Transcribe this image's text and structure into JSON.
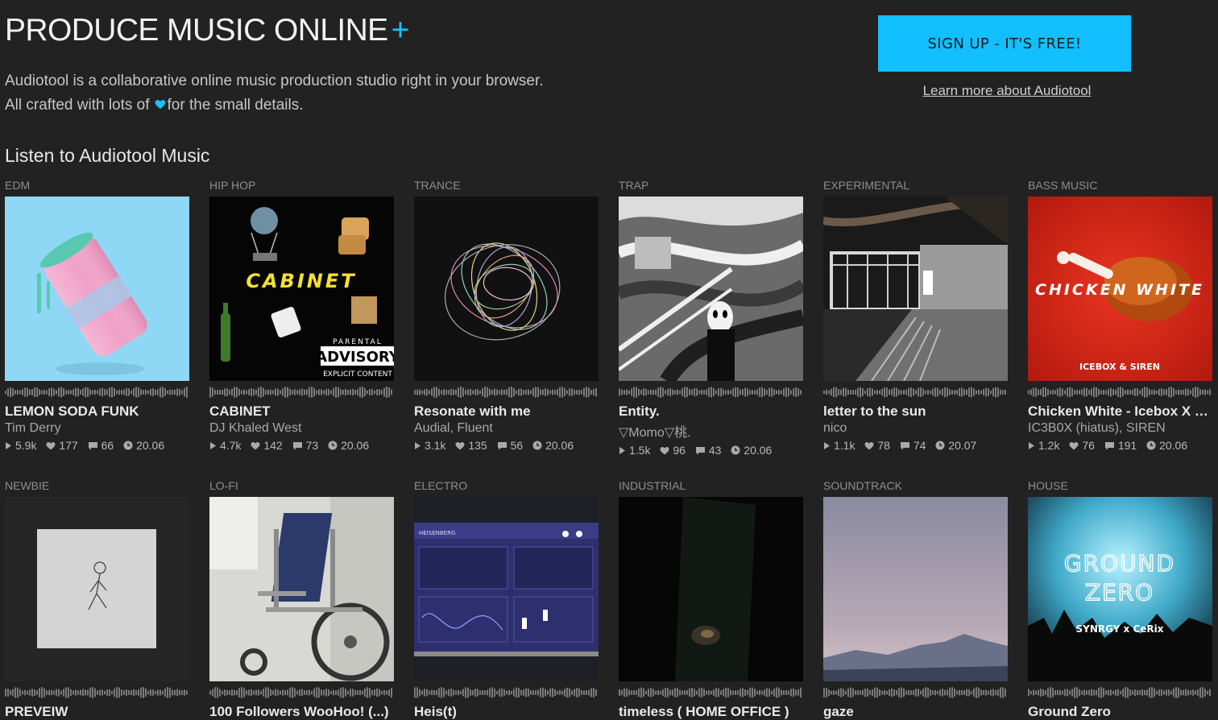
{
  "hero": {
    "title": "PRODUCE MUSIC ONLINE",
    "plus": "+",
    "line1": "Audiotool is a collaborative online music production studio right in your browser.",
    "line2_before": "All crafted with lots of",
    "line2_after": "for the small details."
  },
  "cta": {
    "signup_label": "SIGN UP - IT'S FREE!",
    "learn_more": "Learn more about Audiotool"
  },
  "colors": {
    "accent": "#12bfff",
    "background": "#222222"
  },
  "section": {
    "title": "Listen to Audiotool Music"
  },
  "tracks_row1": [
    {
      "genre": "EDM",
      "title": "LEMON SODA FUNK",
      "artist": "Tim Derry",
      "plays": "5.9k",
      "likes": "177",
      "comments": "66",
      "date": "20.06"
    },
    {
      "genre": "HIP HOP",
      "title": "CABINET",
      "artist": "DJ Khaled West",
      "plays": "4.7k",
      "likes": "142",
      "comments": "73",
      "date": "20.06"
    },
    {
      "genre": "TRANCE",
      "title": "Resonate with me",
      "artist": "Audial, Fluent",
      "plays": "3.1k",
      "likes": "135",
      "comments": "56",
      "date": "20.06"
    },
    {
      "genre": "TRAP",
      "title": "Entity.",
      "artist": "▽Momo▽桃.",
      "plays": "1.5k",
      "likes": "96",
      "comments": "43",
      "date": "20.06"
    },
    {
      "genre": "EXPERIMENTAL",
      "title": "letter to the sun",
      "artist": "nico",
      "plays": "1.1k",
      "likes": "78",
      "comments": "74",
      "date": "20.07"
    },
    {
      "genre": "BASS MUSIC",
      "title": "Chicken White - Icebox X SIREN",
      "artist": "IC3B0X (hiatus), SIREN",
      "plays": "1.2k",
      "likes": "76",
      "comments": "191",
      "date": "20.06"
    }
  ],
  "tracks_row2": [
    {
      "genre": "NEWBIE",
      "title": "PREVEIW"
    },
    {
      "genre": "LO-FI",
      "title": "100 Followers WooHoo! (...)"
    },
    {
      "genre": "ELECTRO",
      "title": "Heis(t)"
    },
    {
      "genre": "INDUSTRIAL",
      "title": "timeless ( HOME OFFICE )"
    },
    {
      "genre": "SOUNDTRACK",
      "title": "gaze"
    },
    {
      "genre": "HOUSE",
      "title": "Ground Zero"
    }
  ],
  "cover_text": {
    "cabinet": "CABINET",
    "parental": "PARENTAL",
    "advisory": "ADVISORY",
    "explicit": "EXPLICIT CONTENT",
    "chicken": "CHICKEN WHITE",
    "icebox": "ICEBOX & SIREN",
    "heisenberg": "HEISENBERG",
    "ground": "GROUND",
    "zero": "ZERO",
    "synrgy": "SYNRGY x CeRix"
  }
}
